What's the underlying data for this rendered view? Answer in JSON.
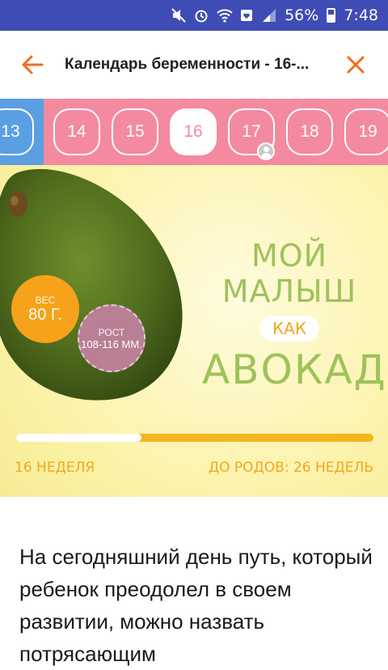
{
  "status_bar": {
    "battery": "56%",
    "time": "7:48"
  },
  "header": {
    "title": "Календарь беременности - 16-..."
  },
  "weeks": {
    "items": [
      {
        "label": "13"
      },
      {
        "label": "14"
      },
      {
        "label": "15"
      },
      {
        "label": "16"
      },
      {
        "label": "17"
      },
      {
        "label": "18"
      },
      {
        "label": "19"
      }
    ],
    "current": "16"
  },
  "banner": {
    "weight_label": "ВЕС",
    "weight_value": "80 Г.",
    "height_label": "РОСТ",
    "height_value": "108-116 ММ.",
    "line1": "МОЙ МАЛЫШ",
    "line2": "КАК",
    "line3": "АВОКАДО",
    "progress": 0.35,
    "week_label": "16 НЕДЕЛЯ",
    "remaining_label": "ДО РОДОВ: 26 НЕДЕЛЬ"
  },
  "article": {
    "text": "На сегодняшний день путь, который ребенок преодолел в своем развитии, можно назвать потрясающим"
  },
  "colors": {
    "accent": "#f26b1f",
    "status_bar": "#3f4cb5",
    "week_strip": "#f48aa0",
    "week_prev": "#5b9fe3"
  }
}
